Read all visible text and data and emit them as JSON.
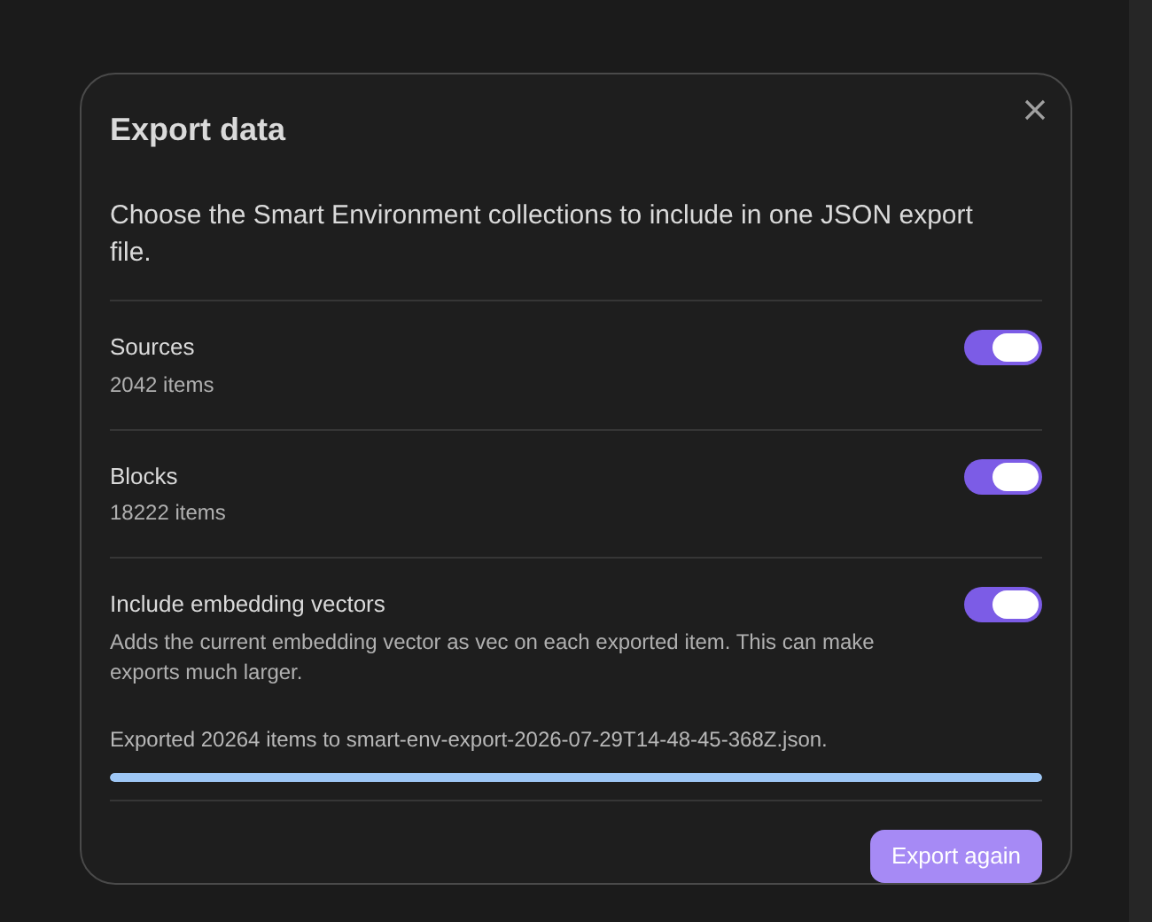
{
  "dialog": {
    "title": "Export data",
    "description": "Choose the Smart Environment collections to include in one JSON export file.",
    "settings": [
      {
        "name": "Sources",
        "description": "2042 items",
        "on": true
      },
      {
        "name": "Blocks",
        "description": "18222 items",
        "on": true
      },
      {
        "name": "Include embedding vectors",
        "description": "Adds the current embedding vector as vec on each exported item. This can make exports much larger.",
        "on": true
      }
    ],
    "status": "Exported 20264 items to smart-env-export-2026-07-29T14-48-45-368Z.json.",
    "progress": {
      "level": 1
    },
    "button": "Export again"
  }
}
